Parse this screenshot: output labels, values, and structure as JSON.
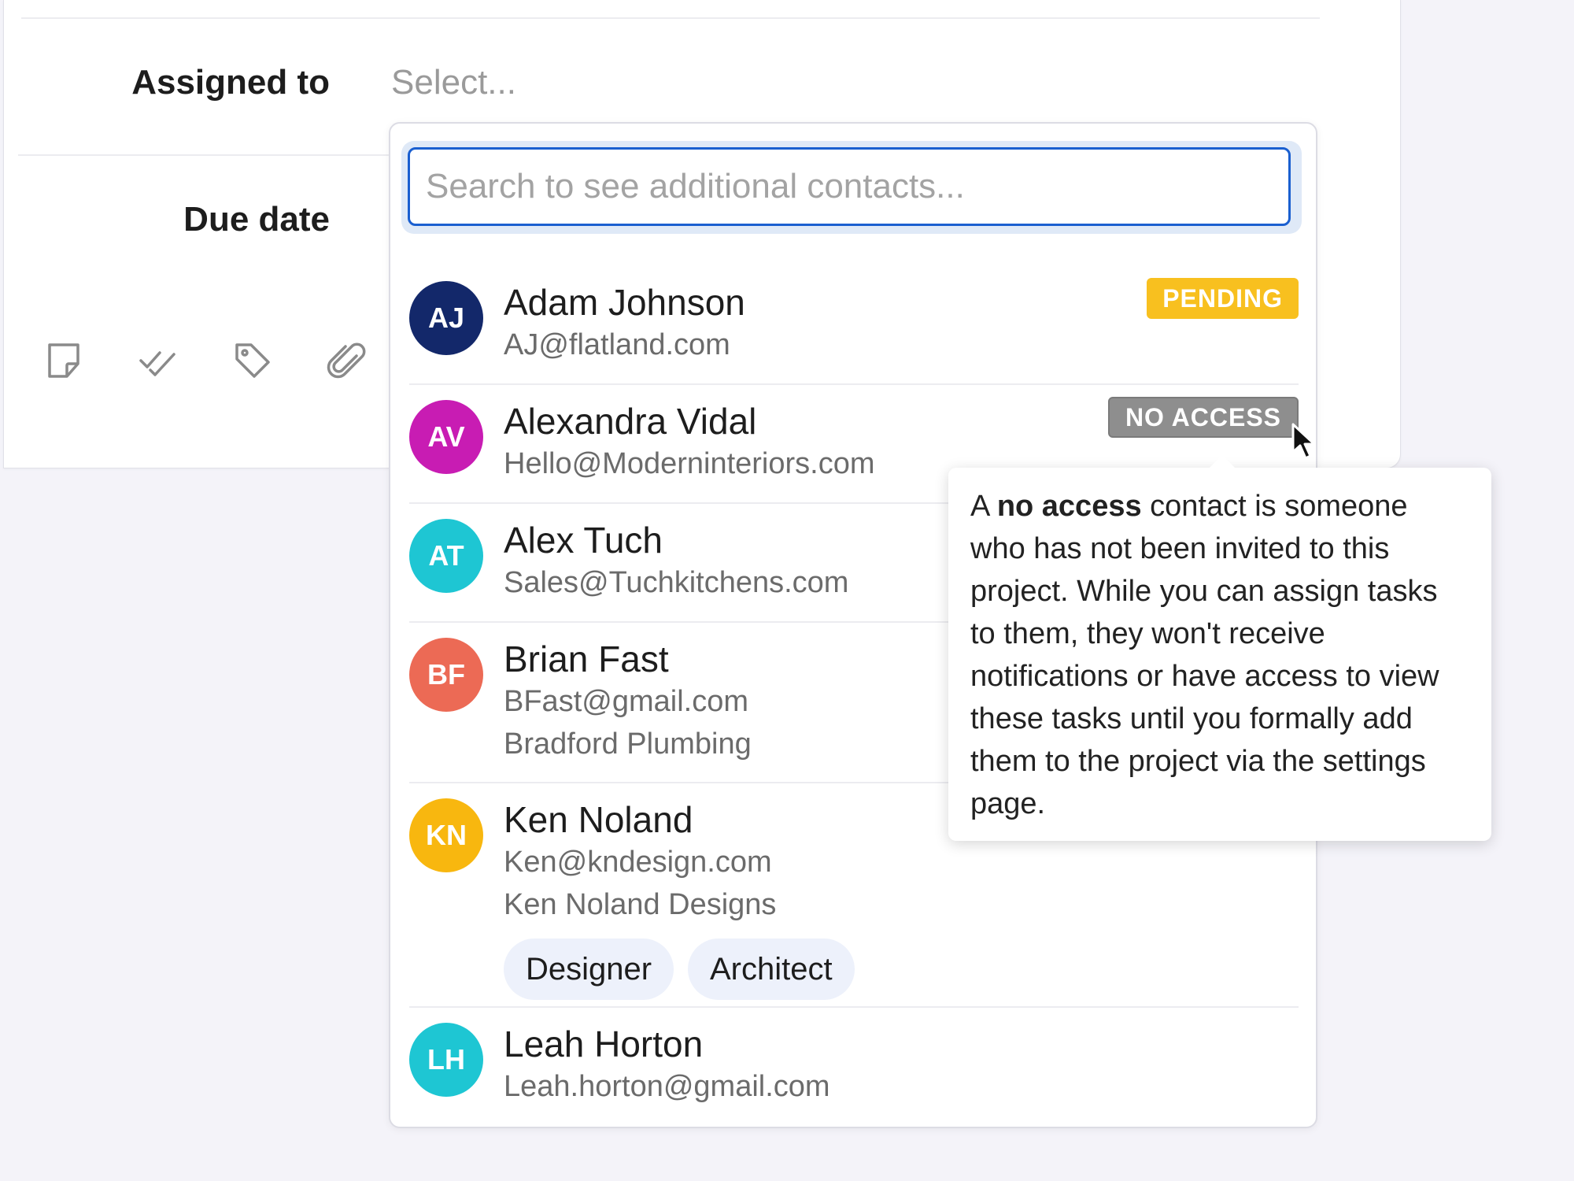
{
  "form": {
    "assigned_label": "Assigned to",
    "assigned_value": "Select...",
    "due_label": "Due date",
    "toolbar_icons": [
      "note-icon",
      "checklist-icon",
      "tag-icon",
      "attachment-icon"
    ]
  },
  "dropdown": {
    "search_placeholder": "Search to see additional contacts...",
    "search_value": "",
    "contacts": [
      {
        "initials": "AJ",
        "name": "Adam Johnson",
        "email": "AJ@flatland.com",
        "avatar_color": "#13286a",
        "badge": "PENDING"
      },
      {
        "initials": "AV",
        "name": "Alexandra Vidal",
        "email": "Hello@Moderninteriors.com",
        "avatar_color": "#c81cb3",
        "badge": "NO ACCESS"
      },
      {
        "initials": "AT",
        "name": "Alex Tuch",
        "email": "Sales@Tuchkitchens.com",
        "avatar_color": "#1ec6d3"
      },
      {
        "initials": "BF",
        "name": "Brian Fast",
        "email": "BFast@gmail.com",
        "company": "Bradford Plumbing",
        "avatar_color": "#ec6a55"
      },
      {
        "initials": "KN",
        "name": "Ken Noland",
        "email": "Ken@kndesign.com",
        "company": "Ken Noland Designs",
        "avatar_color": "#f8b70f",
        "tags": [
          "Designer",
          "Architect"
        ]
      },
      {
        "initials": "LH",
        "name": "Leah Horton",
        "email": "Leah.horton@gmail.com",
        "avatar_color": "#1ec6d3"
      }
    ]
  },
  "tooltip": {
    "prefix": "A ",
    "bold": "no access",
    "text": " contact is someone who has not been invited to this project. While you can assign tasks to them, they won't receive notifications or have access to view these tasks until you formally add them to the project via the settings page."
  },
  "colors": {
    "pending": "#f8c01f",
    "no_access": "#8e8e8e",
    "focus_ring": "#1a5fd0",
    "tag_bg": "#edf1fb"
  }
}
